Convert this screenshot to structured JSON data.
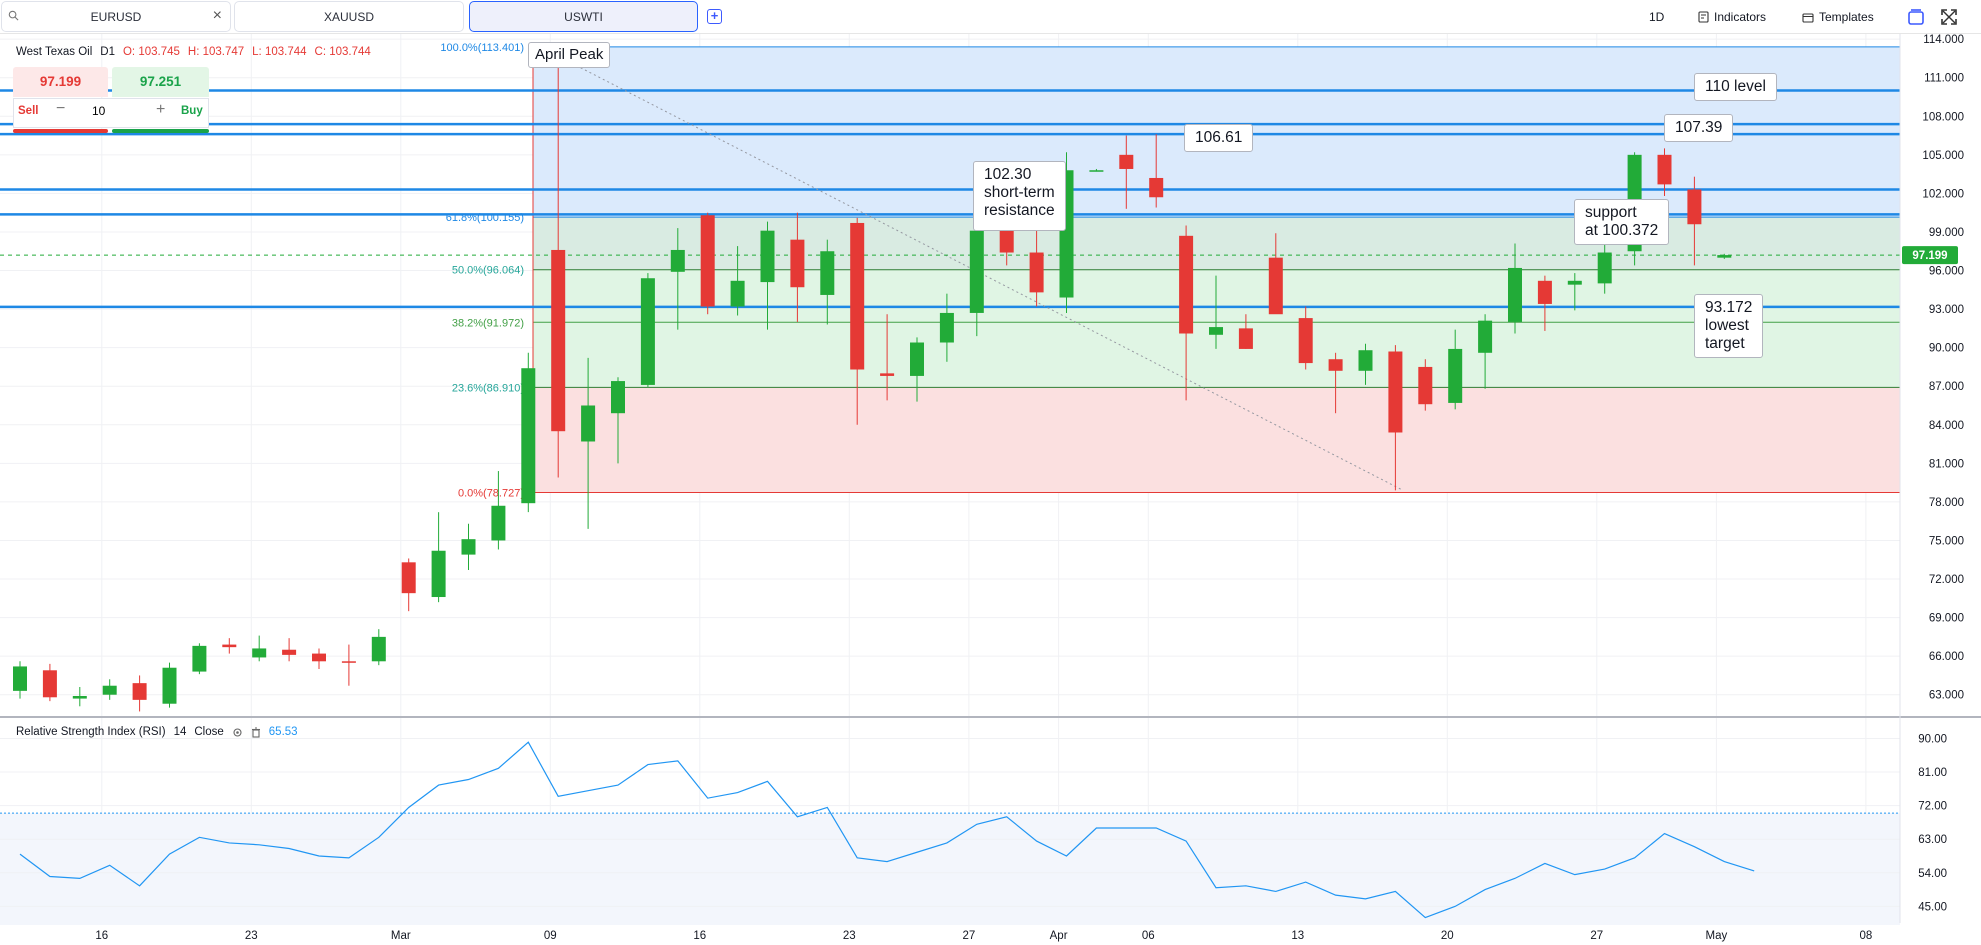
{
  "tabs": [
    {
      "label": "EURUSD",
      "has_search": true,
      "has_close": true
    },
    {
      "label": "XAUUSD"
    },
    {
      "label": "USWTI",
      "active": true
    }
  ],
  "toolbar": {
    "interval": "1D",
    "indicators": "Indicators",
    "templates": "Templates"
  },
  "legend": {
    "symbol": "West Texas Oil",
    "interval": "D1",
    "open": "O: 103.745",
    "high": "H: 103.747",
    "low": "L: 103.744",
    "close": "C: 103.744"
  },
  "trade": {
    "sell_price": "97.199",
    "buy_price": "97.251",
    "sell_label": "Sell",
    "buy_label": "Buy",
    "quantity": "10"
  },
  "rsi": {
    "name": "Relative Strength Index (RSI)",
    "period": "14",
    "source": "Close",
    "value": "65.53"
  },
  "current_price": "97.199",
  "colors": {
    "up": "#22ab38",
    "down": "#e53935",
    "hline": "#1e88e5",
    "fib_blue": "#dbeafc",
    "fib_green": "#e0f5e4",
    "fib_red": "#fbe0e0",
    "rsi": "#2196f3"
  },
  "callouts": {
    "april_peak": "April Peak",
    "level_106": "106.61",
    "level_110": "110 level",
    "level_107": "107.39",
    "short_term": "102.30\nshort-term\nresistance",
    "support": "support\nat 100.372",
    "lowest": "93.172\nlowest\ntarget"
  },
  "chart_data": {
    "type": "candlestick",
    "ylim": [
      61.5,
      114.4
    ],
    "y_ticks": [
      "114.000",
      "111.000",
      "108.000",
      "105.000",
      "102.000",
      "99.000",
      "96.000",
      "93.000",
      "90.000",
      "87.000",
      "84.000",
      "81.000",
      "78.000",
      "75.000",
      "72.000",
      "69.000",
      "66.000",
      "63.000"
    ],
    "x_ticks": [
      "16",
      "23",
      "Mar",
      "09",
      "16",
      "23",
      "27",
      "Apr",
      "06",
      "13",
      "20",
      "27",
      "May",
      "08"
    ],
    "candles": [
      {
        "o": 63.3,
        "h": 65.6,
        "l": 62.7,
        "c": 65.2
      },
      {
        "o": 64.9,
        "h": 65.4,
        "l": 62.5,
        "c": 62.8
      },
      {
        "o": 62.7,
        "h": 63.6,
        "l": 62.1,
        "c": 62.9
      },
      {
        "o": 63.0,
        "h": 64.2,
        "l": 62.6,
        "c": 63.7
      },
      {
        "o": 63.9,
        "h": 64.5,
        "l": 61.7,
        "c": 62.6
      },
      {
        "o": 62.3,
        "h": 65.5,
        "l": 62.0,
        "c": 65.1
      },
      {
        "o": 64.8,
        "h": 67.0,
        "l": 64.6,
        "c": 66.8
      },
      {
        "o": 66.9,
        "h": 67.4,
        "l": 66.2,
        "c": 66.7
      },
      {
        "o": 65.9,
        "h": 67.6,
        "l": 65.6,
        "c": 66.6
      },
      {
        "o": 66.5,
        "h": 67.4,
        "l": 65.6,
        "c": 66.1
      },
      {
        "o": 66.2,
        "h": 66.6,
        "l": 65.0,
        "c": 65.6
      },
      {
        "o": 65.6,
        "h": 66.9,
        "l": 63.7,
        "c": 65.5
      },
      {
        "o": 65.6,
        "h": 68.1,
        "l": 65.3,
        "c": 67.5
      },
      {
        "o": 73.3,
        "h": 73.6,
        "l": 69.5,
        "c": 70.9
      },
      {
        "o": 70.6,
        "h": 77.2,
        "l": 70.2,
        "c": 74.2
      },
      {
        "o": 73.9,
        "h": 76.3,
        "l": 72.7,
        "c": 75.1
      },
      {
        "o": 75.0,
        "h": 80.4,
        "l": 74.3,
        "c": 77.7
      },
      {
        "o": 77.9,
        "h": 89.6,
        "l": 77.2,
        "c": 88.4
      },
      {
        "o": 97.6,
        "h": 113.4,
        "l": 79.9,
        "c": 83.5
      },
      {
        "o": 82.7,
        "h": 89.2,
        "l": 75.9,
        "c": 85.5
      },
      {
        "o": 84.9,
        "h": 87.7,
        "l": 81.0,
        "c": 87.4
      },
      {
        "o": 87.1,
        "h": 95.8,
        "l": 86.9,
        "c": 95.4
      },
      {
        "o": 95.9,
        "h": 99.3,
        "l": 91.4,
        "c": 97.6
      },
      {
        "o": 100.3,
        "h": 100.5,
        "l": 92.6,
        "c": 93.2
      },
      {
        "o": 93.2,
        "h": 97.9,
        "l": 92.5,
        "c": 95.2
      },
      {
        "o": 95.1,
        "h": 99.8,
        "l": 91.4,
        "c": 99.1
      },
      {
        "o": 98.4,
        "h": 100.5,
        "l": 92.0,
        "c": 94.7
      },
      {
        "o": 94.1,
        "h": 98.4,
        "l": 91.8,
        "c": 97.5
      },
      {
        "o": 99.7,
        "h": 100.1,
        "l": 84.0,
        "c": 88.3
      },
      {
        "o": 88.0,
        "h": 92.6,
        "l": 85.9,
        "c": 87.8
      },
      {
        "o": 87.8,
        "h": 90.8,
        "l": 85.8,
        "c": 90.4
      },
      {
        "o": 90.4,
        "h": 94.2,
        "l": 88.9,
        "c": 92.7
      },
      {
        "o": 92.7,
        "h": 103.4,
        "l": 90.9,
        "c": 99.1
      },
      {
        "o": 99.6,
        "h": 102.4,
        "l": 96.4,
        "c": 97.4
      },
      {
        "o": 97.4,
        "h": 102.3,
        "l": 93.2,
        "c": 94.3
      },
      {
        "o": 93.9,
        "h": 105.2,
        "l": 92.7,
        "c": 103.8
      },
      {
        "o": 103.8,
        "h": 103.9,
        "l": 103.7,
        "c": 103.8
      },
      {
        "o": 105.0,
        "h": 106.5,
        "l": 100.8,
        "c": 103.9
      },
      {
        "o": 103.2,
        "h": 106.6,
        "l": 100.9,
        "c": 101.7
      },
      {
        "o": 98.7,
        "h": 99.5,
        "l": 85.9,
        "c": 91.1
      },
      {
        "o": 91.0,
        "h": 95.6,
        "l": 89.9,
        "c": 91.6
      },
      {
        "o": 91.5,
        "h": 92.6,
        "l": 89.9,
        "c": 89.9
      },
      {
        "o": 97.0,
        "h": 98.9,
        "l": 92.7,
        "c": 92.6
      },
      {
        "o": 92.3,
        "h": 93.2,
        "l": 88.3,
        "c": 88.8
      },
      {
        "o": 89.1,
        "h": 89.6,
        "l": 84.9,
        "c": 88.2
      },
      {
        "o": 88.2,
        "h": 90.3,
        "l": 87.1,
        "c": 89.8
      },
      {
        "o": 89.7,
        "h": 90.2,
        "l": 78.9,
        "c": 83.4
      },
      {
        "o": 88.5,
        "h": 89.1,
        "l": 85.1,
        "c": 85.6
      },
      {
        "o": 85.7,
        "h": 91.4,
        "l": 85.2,
        "c": 89.9
      },
      {
        "o": 89.6,
        "h": 92.6,
        "l": 86.8,
        "c": 92.1
      },
      {
        "o": 92.0,
        "h": 98.1,
        "l": 91.1,
        "c": 96.2
      },
      {
        "o": 95.2,
        "h": 95.6,
        "l": 91.3,
        "c": 93.4
      },
      {
        "o": 94.9,
        "h": 95.8,
        "l": 92.9,
        "c": 95.2
      },
      {
        "o": 95.0,
        "h": 98.2,
        "l": 94.2,
        "c": 97.4
      },
      {
        "o": 97.5,
        "h": 105.2,
        "l": 96.4,
        "c": 105.0
      },
      {
        "o": 105.0,
        "h": 105.5,
        "l": 101.8,
        "c": 102.7
      },
      {
        "o": 102.3,
        "h": 103.3,
        "l": 96.4,
        "c": 99.6
      },
      {
        "o": 97.0,
        "h": 97.3,
        "l": 96.9,
        "c": 97.2
      }
    ],
    "fib_levels": [
      {
        "ratio": 1.0,
        "label": "100.0%(113.401)",
        "price": 113.401
      },
      {
        "ratio": 0.618,
        "label": "61.8%(100.155)",
        "price": 100.155
      },
      {
        "ratio": 0.5,
        "label": "50.0%(96.064)",
        "price": 96.064
      },
      {
        "ratio": 0.382,
        "label": "38.2%(91.972)",
        "price": 91.972
      },
      {
        "ratio": 0.236,
        "label": "23.6%(86.910)",
        "price": 86.91
      },
      {
        "ratio": 0.0,
        "label": "0.0%(78.727)",
        "price": 78.727
      }
    ],
    "horizontal_levels": [
      110.0,
      107.39,
      106.61,
      102.3,
      100.372,
      93.172
    ],
    "rsi": {
      "ylim": [
        40,
        92
      ],
      "y_ticks": [
        "90.00",
        "81.00",
        "72.00",
        "63.00",
        "54.00",
        "45.00"
      ],
      "overbought": 70,
      "values": [
        59,
        53,
        52.5,
        56,
        50.5,
        59,
        63.5,
        62,
        61.5,
        60.5,
        58.5,
        58,
        63.5,
        71.5,
        77.5,
        79,
        82,
        89,
        74.5,
        76,
        77.5,
        83,
        84,
        74,
        75.5,
        78.5,
        69,
        71.5,
        58,
        57,
        59.5,
        62,
        67,
        69,
        62.5,
        58.5,
        66,
        66,
        66,
        62.5,
        50,
        50.5,
        49,
        51.5,
        48,
        47,
        49,
        42,
        45,
        49.5,
        52.5,
        56.5,
        53.5,
        55,
        58,
        64.5,
        61,
        57,
        54.5
      ]
    }
  }
}
